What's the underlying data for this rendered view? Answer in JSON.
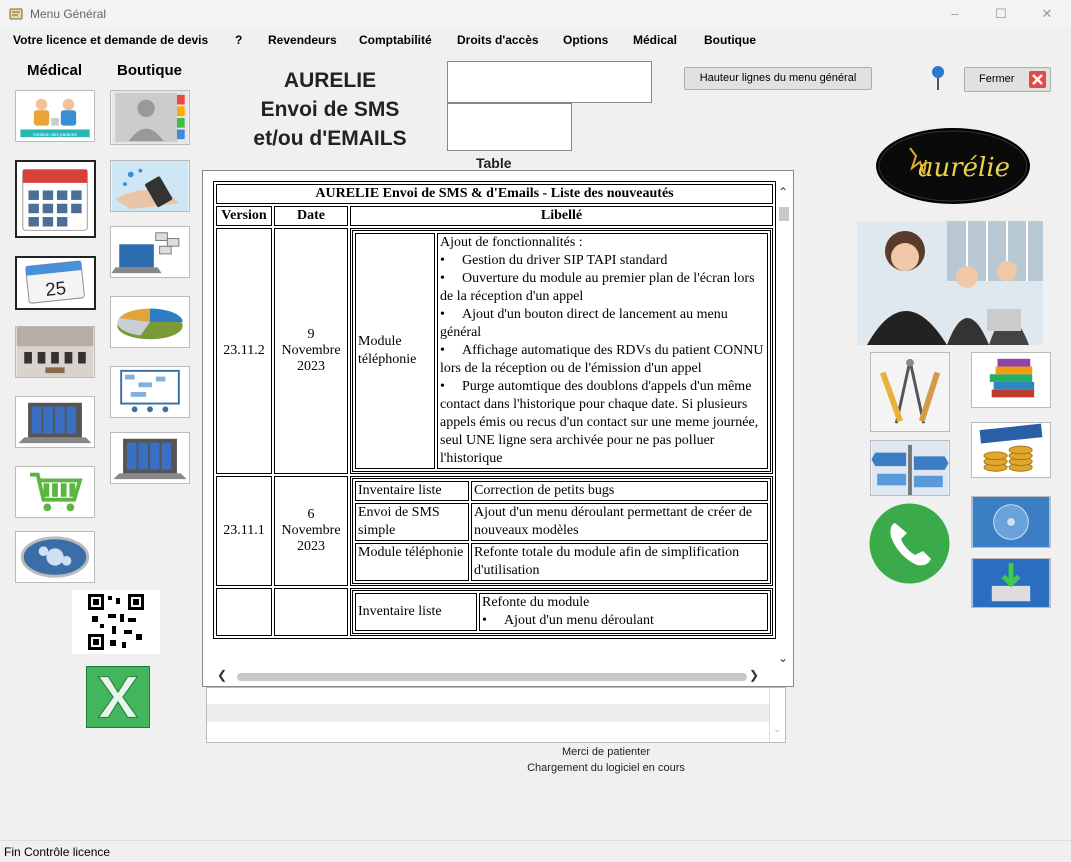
{
  "window": {
    "title": "Menu Général"
  },
  "menu": [
    "Votre licence et demande de devis",
    "?",
    "Revendeurs",
    "Comptabilité",
    "Droits d'accès",
    "Options",
    "Médical",
    "Boutique"
  ],
  "columns": {
    "medical": "Médical",
    "boutique": "Boutique"
  },
  "header": {
    "title_line1": "AURELIE",
    "title_line2": "Envoi de SMS",
    "title_line3": "et/ou d'EMAILS"
  },
  "table_label": "Table",
  "buttons": {
    "row_height": "Hauteur lignes du menu général",
    "close": "Fermer"
  },
  "logo_text": "aurélie",
  "calendar_day": "25",
  "news_table": {
    "title": "AURELIE Envoi de SMS & d'Emails - Liste des nouveautés",
    "headers": [
      "Version",
      "Date",
      "Libellé"
    ],
    "row1": {
      "version": "23.11.2",
      "date": "9 Novembre 2023",
      "module": "Module téléphonie",
      "intro": "Ajout de fonctionnalités :",
      "bullets": [
        "Gestion du driver SIP TAPI standard",
        "Ouverture du module au premier plan de l'écran lors de la réception d'un appel",
        "Ajout d'un bouton direct de lancement au menu général",
        "Affichage automatique des RDVs du patient CONNU lors de la réception ou de l'émission d'un appel",
        "Purge automtique des doublons d'appels d'un même contact dans l'historique pour chaque date. Si plusieurs appels émis ou recus d'un contact sur une meme journée, seul UNE ligne sera archivée pour ne pas polluer l'historique"
      ]
    },
    "row2": {
      "version": "23.11.1",
      "date": "6 Novembre 2023",
      "items": [
        {
          "module": "Inventaire liste",
          "text": "Correction de petits bugs"
        },
        {
          "module": "Envoi de SMS simple",
          "text": "Ajout d'un menu déroulant permettant de créer de nouveaux modèles"
        },
        {
          "module": "Module téléphonie",
          "text": "Refonte totale du module afin de simplification d'utilisation"
        }
      ]
    },
    "row3": {
      "module": "Inventaire liste",
      "intro": "Refonte du module",
      "bullet": "Ajout d'un menu déroulant"
    }
  },
  "status": {
    "line1": "Merci de patienter",
    "line2": "Chargement du logiciel en cours",
    "footer": "Fin Contrôle licence"
  },
  "tiles": [
    "Gestion des patients"
  ]
}
